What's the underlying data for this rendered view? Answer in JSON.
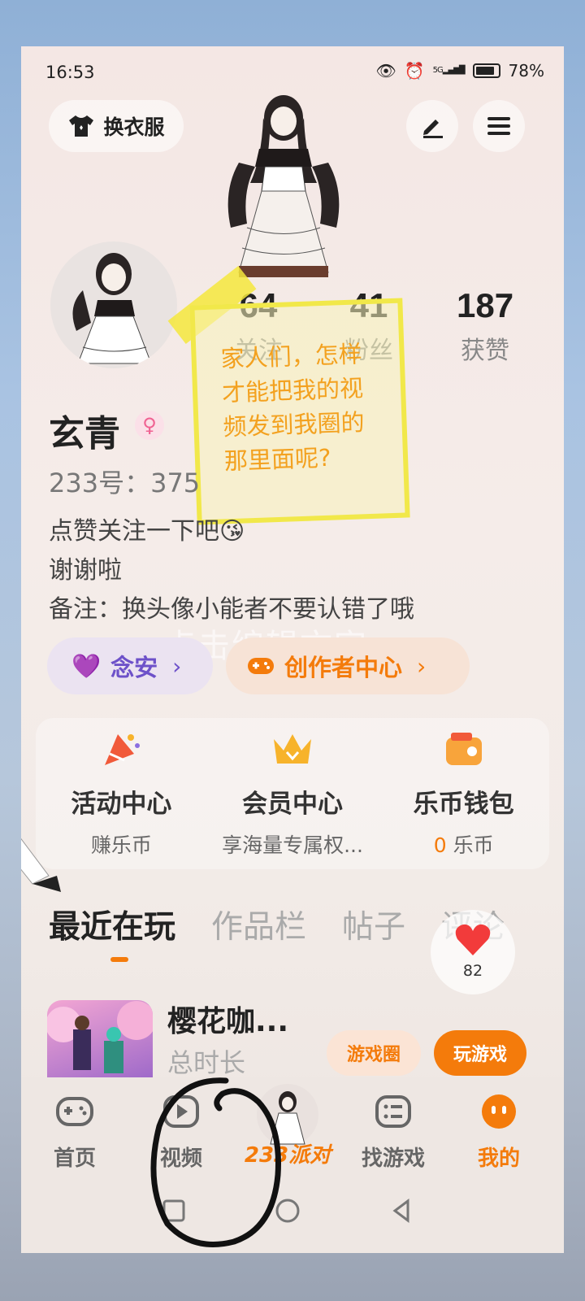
{
  "status_bar": {
    "time": "16:53",
    "network": "5G",
    "battery": "78%"
  },
  "header": {
    "outfit_button": "换衣服"
  },
  "profile": {
    "stats": [
      {
        "value": "64",
        "label": "关注"
      },
      {
        "value": "41",
        "label": "粉丝"
      },
      {
        "value": "187",
        "label": "获赞"
      }
    ],
    "name": "玄青",
    "gender_symbol": "♀",
    "id_text": "233号：375",
    "bio_line1": "点赞关注一下吧😘",
    "bio_line2": "谢谢啦",
    "bio_line3": "备注：换头像小能者不要认错了哦"
  },
  "sticky_note": {
    "text": "家人们，怎样才能把我的视频发到我圈的那里面呢?"
  },
  "watermark": "点击编辑文字",
  "chips": {
    "friend": "念安",
    "creator": "创作者中心",
    "arrow": "›"
  },
  "cards": [
    {
      "title": "活动中心",
      "sub": "赚乐币"
    },
    {
      "title": "会员中心",
      "sub": "享海量专属权..."
    },
    {
      "title": "乐币钱包",
      "sub_value": "0",
      "sub": "乐币"
    }
  ],
  "tabs": [
    "最近在玩",
    "作品栏",
    "帖子",
    "评论"
  ],
  "like_bubble": {
    "count": "82"
  },
  "recent_game": {
    "title": "樱花咖...",
    "subtitle": "总时长",
    "circle_btn": "游戏圈",
    "play_btn": "玩游戏"
  },
  "bottom_nav": {
    "items": [
      "首页",
      "视频",
      "233派对",
      "找游戏",
      "我的"
    ],
    "active": "我的"
  },
  "colors": {
    "accent": "#f47b0b",
    "purple": "#6d51c9",
    "note_border": "#f1e84a",
    "note_text": "#f3a11f"
  }
}
